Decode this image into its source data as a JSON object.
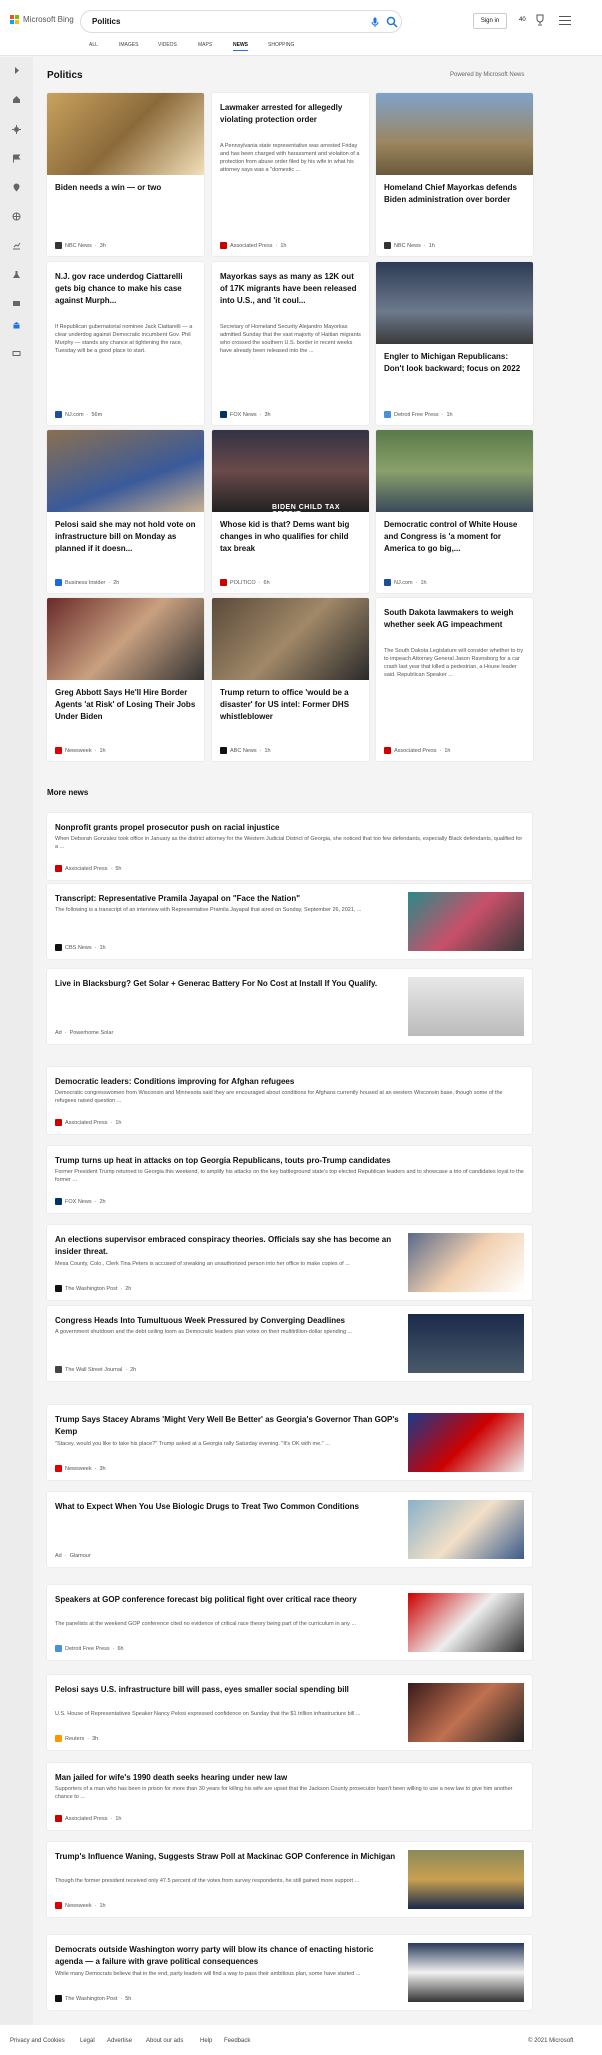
{
  "header": {
    "brand": "Microsoft Bing",
    "search_value": "Politics",
    "signin": "Sign in",
    "points": "40"
  },
  "tabs": [
    "ALL",
    "IMAGES",
    "VIDEOS",
    "MAPS",
    "NEWS",
    "SHOPPING"
  ],
  "section": {
    "title": "Politics",
    "powered": "Powered by Microsoft News"
  },
  "cards": [
    {
      "title": "Biden needs a win — or two",
      "abstract": "",
      "source": "NBC News",
      "time": "3h"
    },
    {
      "title": "Lawmaker arrested for allegedly violating protection order",
      "abstract": "A Pennsylvania state representative was arrested Friday and has been charged with harassment and violation of a protection from abuse order filed by his wife in what his attorney says was a \"domestic ...",
      "source": "Associated Press",
      "time": "1h"
    },
    {
      "title": "Homeland Chief Mayorkas defends Biden administration over border",
      "abstract": "",
      "source": "NBC News",
      "time": "1h"
    },
    {
      "title": "N.J. gov race underdog Ciattarelli gets big chance to make his case against Murph...",
      "abstract": "If Republican gubernatorial nominee Jack Ciattarelli — a clear underdog against Democratic incumbent Gov. Phil Murphy — stands any chance at tightening the race, Tuesday will be a good place to start.",
      "source": "NJ.com",
      "time": "56m"
    },
    {
      "title": "Mayorkas says as many as 12K out of 17K migrants have been released into U.S., and 'it coul...",
      "abstract": "Secretary of Homeland Security Alejandro Mayorkas admitted Sunday that the vast majority of Haitian migrants who crossed the southern U.S. border in recent weeks have already been released into the ...",
      "source": "FOX News",
      "time": "3h"
    },
    {
      "title": "Engler to Michigan Republicans: Don't look backward; focus on 2022",
      "abstract": "",
      "source": "Detroit Free Press",
      "time": "1h"
    },
    {
      "title": "Pelosi said she may not hold vote on infrastructure bill on Monday as planned if it doesn...",
      "abstract": "",
      "source": "Business Insider",
      "time": "2h"
    },
    {
      "title": "Whose kid is that? Dems want big changes in who qualifies for child tax break",
      "abstract": "",
      "source": "POLITICO",
      "time": "6h",
      "overlay": "BIDEN CHILD TAX CREDIT"
    },
    {
      "title": "Democratic control of White House and Congress is 'a moment for America to go big,...",
      "abstract": "",
      "source": "NJ.com",
      "time": "1h"
    },
    {
      "title": "Greg Abbott Says He'll Hire Border Agents 'at Risk' of Losing Their Jobs Under Biden",
      "abstract": "",
      "source": "Newsweek",
      "time": "1h"
    },
    {
      "title": "Trump return to office 'would be a disaster' for US intel: Former DHS whistleblower",
      "abstract": "",
      "source": "ABC News",
      "time": "1h"
    },
    {
      "title": "South Dakota lawmakers to weigh whether seek AG impeachment",
      "abstract": "The South Dakota Legislature will consider whether to try to impeach Attorney General Jason Ravnsborg for a car crash last year that killed a pedestrian, a House leader said. Republican Speaker ...",
      "source": "Associated Press",
      "time": "1h"
    }
  ],
  "more_title": "More news",
  "rows": [
    {
      "title": "Nonprofit grants propel prosecutor push on racial injustice",
      "abstract": "When Deborah Gonzalez took office in January as the district attorney for the Western Judicial District of Georgia, she noticed that too few defendants, especially Black defendants, qualified for a ...",
      "source": "Associated Press",
      "time": "5h",
      "ad": ""
    },
    {
      "title": "Transcript: Representative Pramila Jayapal on \"Face the Nation\"",
      "abstract": "The following is a transcript of an interview with Representative Pramila Jayapal that aired on Sunday, September 26, 2021, ...",
      "source": "CBS News",
      "time": "1h",
      "ad": ""
    },
    {
      "title": "Live in Blacksburg? Get Solar + Generac Battery For No Cost at Install If You Qualify.",
      "abstract": "",
      "source": "Powerhome Solar",
      "time": "",
      "ad": "Ad"
    },
    {
      "title": "Democratic leaders: Conditions improving for Afghan refugees",
      "abstract": "Democratic congresswomen from Wisconsin and Minnesota said they are encouraged about conditions for Afghans currently housed at an western Wisconsin base, though some of the refugees raised question ...",
      "source": "Associated Press",
      "time": "1h",
      "ad": ""
    },
    {
      "title": "Trump turns up heat in attacks on top Georgia Republicans, touts pro-Trump candidates",
      "abstract": "Former President Trump returned to Georgia this weekend, to amplify his attacks on the key battleground state's top elected Republican leaders and to showcase a trio of candidates loyal to the former ...",
      "source": "FOX News",
      "time": "2h",
      "ad": ""
    },
    {
      "title": "An elections supervisor embraced conspiracy theories. Officials say she has become an insider threat.",
      "abstract": "Mesa County, Colo., Clerk Tina Peters is accused of sneaking an unauthorized person into her office to make copies of ...",
      "source": "The Washington Post",
      "time": "2h",
      "ad": ""
    },
    {
      "title": "Congress Heads Into Tumultuous Week Pressured by Converging Deadlines",
      "abstract": "A government shutdown and the debt ceiling loom as Democratic leaders plan votes on their multitrillion-dollar spending ...",
      "source": "The Wall Street Journal",
      "time": "2h",
      "ad": ""
    },
    {
      "title": "Trump Says Stacey Abrams 'Might Very Well Be Better' as Georgia's Governor Than GOP's Kemp",
      "abstract": "\"Stacey, would you like to take his place?\" Trump asked at a Georgia rally Saturday evening. \"It's OK with me.\" ...",
      "source": "Newsweek",
      "time": "3h",
      "ad": ""
    },
    {
      "title": "What to Expect When You Use Biologic Drugs to Treat Two Common Conditions",
      "abstract": "",
      "source": "Glamour",
      "time": "",
      "ad": "Ad"
    },
    {
      "title": "Speakers at GOP conference forecast big political fight over critical race theory",
      "abstract": "The panelists at the weekend GOP conference cited no evidence of critical race theory being part of the curriculum in any ...",
      "source": "Detroit Free Press",
      "time": "6h",
      "ad": ""
    },
    {
      "title": "Pelosi says U.S. infrastructure bill will pass, eyes smaller social spending bill",
      "abstract": "U.S. House of Representatives Speaker Nancy Pelosi expressed confidence on Sunday that the $1 trillion infrastructure bill ...",
      "source": "Reuters",
      "time": "3h",
      "ad": ""
    },
    {
      "title": "Man jailed for wife's 1990 death seeks hearing under new law",
      "abstract": "Supporters of a man who has been in prison for more than 30 years for killing his wife are upset that the Jackson County prosecutor hasn't been willing to use a new law to give him another chance to ...",
      "source": "Associated Press",
      "time": "1h",
      "ad": ""
    },
    {
      "title": "Trump's Influence Waning, Suggests Straw Poll at Mackinac GOP Conference in Michigan",
      "abstract": "Though the former president received only 47.5 percent of the votes from survey respondents, he still gained more support ...",
      "source": "Newsweek",
      "time": "1h",
      "ad": ""
    },
    {
      "title": "Democrats outside Washington worry party will blow its chance of enacting historic agenda — a failure with grave political consequences",
      "abstract": "While many Democrats believe that in the end, party leaders will find a way to pass their ambitious plan, some have started ...",
      "source": "The Washington Post",
      "time": "5h",
      "ad": ""
    }
  ],
  "footer": {
    "links": [
      "Privacy and Cookies",
      "Legal",
      "Advertise",
      "About our ads",
      "Help",
      "Feedback"
    ],
    "copyright": "© 2021 Microsoft"
  }
}
